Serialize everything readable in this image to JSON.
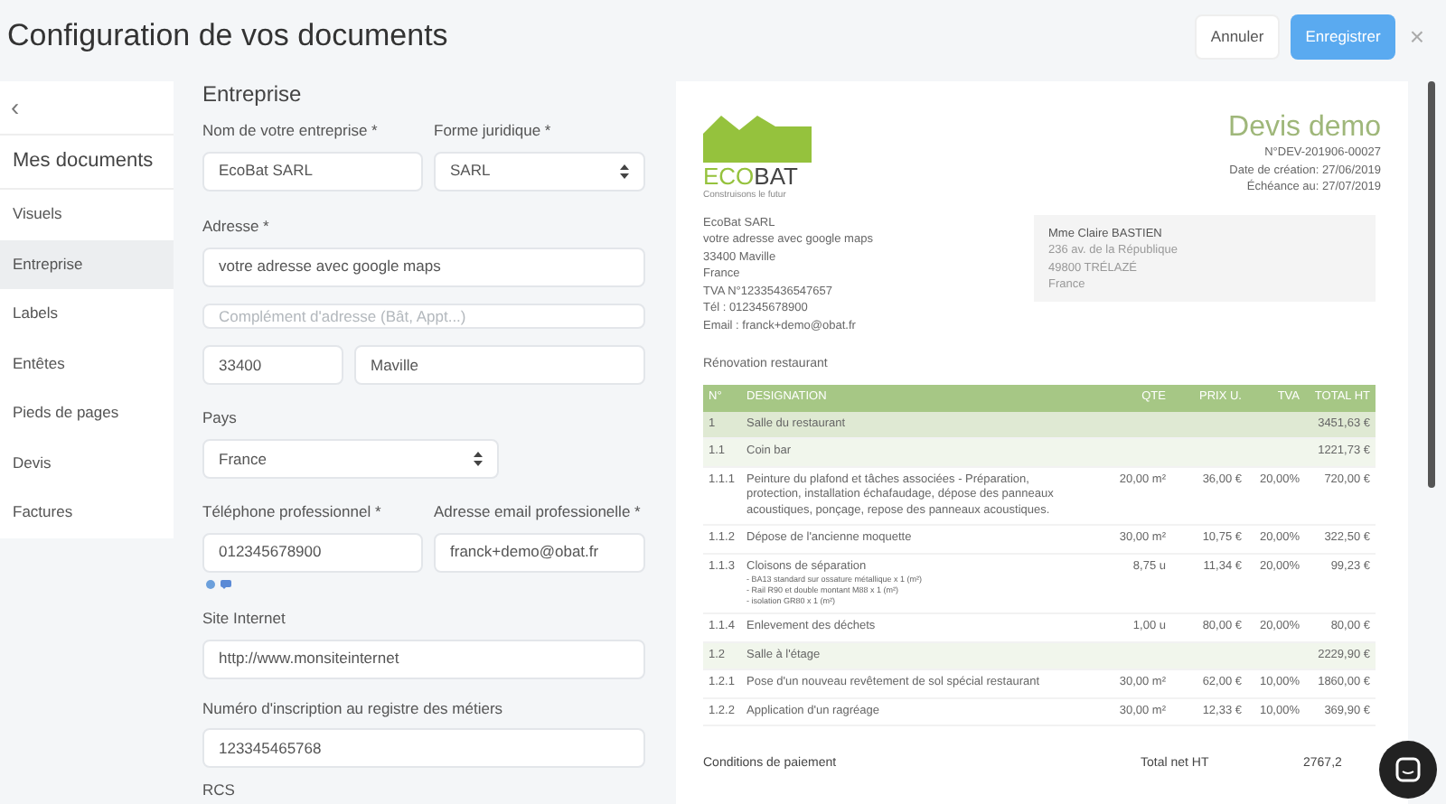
{
  "header": {
    "title": "Configuration de vos documents",
    "buttons": [
      {
        "label": "Annuler",
        "kind": "secondary"
      },
      {
        "label": "Enregistrer",
        "kind": "primary"
      }
    ],
    "close": "×"
  },
  "sidebar": {
    "back": "‹",
    "title": "Mes documents",
    "items": [
      {
        "label": "Visuels",
        "selected": false
      },
      {
        "label": "Entreprise",
        "selected": true
      },
      {
        "label": "Labels",
        "selected": false
      },
      {
        "label": "Entêtes",
        "selected": false
      },
      {
        "label": "Pieds de pages",
        "selected": false
      },
      {
        "label": "Devis",
        "selected": false
      },
      {
        "label": "Factures",
        "selected": false
      }
    ]
  },
  "form": {
    "title": "Entreprise",
    "company_name": {
      "label": "Nom de votre entreprise *",
      "value": "EcoBat SARL"
    },
    "legal_form": {
      "label": "Forme juridique *",
      "value": "SARL"
    },
    "address": {
      "label": "Adresse *",
      "value": "votre adresse avec google maps"
    },
    "address_extra": {
      "placeholder": "Complément d'adresse (Bât, Appt...)"
    },
    "zip": {
      "value": "33400"
    },
    "city": {
      "value": "Maville"
    },
    "country": {
      "label": "Pays",
      "value": "France"
    },
    "phone": {
      "label": "Téléphone professionnel *",
      "value": "012345678900"
    },
    "email": {
      "label": "Adresse email professionelle *",
      "value": "franck+demo@obat.fr"
    },
    "website": {
      "label": "Site Internet",
      "value": "http://www.monsiteinternet"
    },
    "registry": {
      "label": "Numéro d'inscription au registre des métiers",
      "value": "123345465768"
    },
    "rcs": {
      "label": "RCS"
    }
  },
  "preview": {
    "logo": {
      "name_part1": "ECO",
      "name_part2": "BAT",
      "tagline": "Construisons le futur"
    },
    "doc_title": "Devis demo",
    "doc_meta": [
      "N°DEV-201906-00027",
      "Date de création: 27/06/2019",
      "Échéance au: 27/07/2019"
    ],
    "sender": [
      "EcoBat SARL",
      "votre adresse avec google maps",
      "33400 Maville",
      "France",
      "TVA N°12335436547657",
      "Tél : 012345678900",
      "Email : franck+demo@obat.fr"
    ],
    "client": {
      "name": "Mme Claire BASTIEN",
      "lines": [
        "236 av. de la République",
        "49800 TRÉLAZÉ",
        "France"
      ]
    },
    "project": "Rénovation restaurant",
    "columns": [
      "N°",
      "DESIGNATION",
      "QTE",
      "PRIX U.",
      "TVA",
      "TOTAL HT"
    ],
    "rows": [
      {
        "kind": "lot",
        "num": "1",
        "designation": "Salle du restaurant",
        "total": "3451,63 €"
      },
      {
        "kind": "sublot",
        "num": "1.1",
        "designation": "Coin bar",
        "total": "1221,73 €"
      },
      {
        "kind": "line",
        "num": "1.1.1",
        "designation": "Peinture du plafond et tâches associées - Préparation, protection, installation échafaudage, dépose des panneaux acoustiques, ponçage, repose des panneaux acoustiques.",
        "qte": "20,00 m²",
        "prix": "36,00 €",
        "tva": "20,00%",
        "total": "720,00 €"
      },
      {
        "kind": "line",
        "num": "1.1.2",
        "designation": "Dépose de l'ancienne moquette",
        "qte": "30,00 m²",
        "prix": "10,75 €",
        "tva": "20,00%",
        "total": "322,50 €"
      },
      {
        "kind": "line",
        "num": "1.1.3",
        "designation": "Cloisons de séparation",
        "notes": [
          "- BA13 standard sur ossature métallique x 1 (m²)",
          "- Rail R90 et double montant M88 x 1 (m²)",
          "- isolation GR80 x 1 (m²)"
        ],
        "qte": "8,75 u",
        "prix": "11,34 €",
        "tva": "20,00%",
        "total": "99,23 €"
      },
      {
        "kind": "line",
        "num": "1.1.4",
        "designation": "Enlevement des déchets",
        "qte": "1,00 u",
        "prix": "80,00 €",
        "tva": "20,00%",
        "total": "80,00 €"
      },
      {
        "kind": "sublot",
        "num": "1.2",
        "designation": "Salle à l'étage",
        "total": "2229,90 €"
      },
      {
        "kind": "line",
        "num": "1.2.1",
        "designation": "Pose d'un nouveau revêtement de sol spécial restaurant",
        "qte": "30,00 m²",
        "prix": "62,00 €",
        "tva": "10,00%",
        "total": "1860,00 €"
      },
      {
        "kind": "line",
        "num": "1.2.2",
        "designation": "Application d'un ragréage",
        "qte": "30,00 m²",
        "prix": "12,33 €",
        "tva": "10,00%",
        "total": "369,90 €"
      }
    ],
    "footer": {
      "conditions": "Conditions de paiement",
      "total_label": "Total net HT",
      "total_value": "2767,2"
    }
  }
}
